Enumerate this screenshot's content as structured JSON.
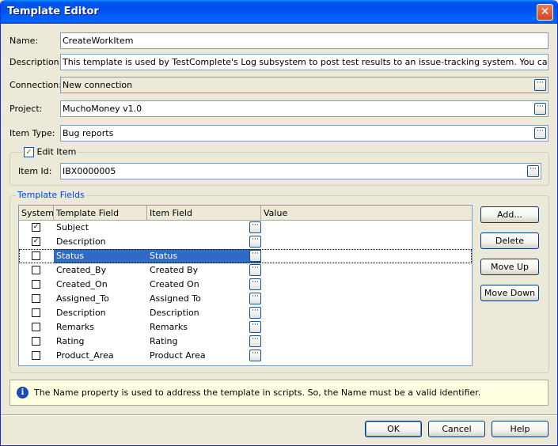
{
  "window": {
    "title": "Template Editor",
    "close_glyph": "✕"
  },
  "form": {
    "name_label": "Name:",
    "name_value": "CreateWorkItem",
    "description_label": "Description:",
    "description_value": "This template is used by TestComplete's Log subsystem to post test results to an issue-tracking system. You can also use it at y",
    "connection_label": "Connection:",
    "connection_value": "New connection",
    "project_label": "Project:",
    "project_value": "MuchoMoney v1.0",
    "itemtype_label": "Item Type:",
    "itemtype_value": "Bug reports"
  },
  "edit_item": {
    "checkbox_label": "Edit Item",
    "checked": true,
    "itemid_label": "Item Id:",
    "itemid_value": "IBX0000005"
  },
  "template_fields": {
    "group_label": "Template Fields",
    "columns": [
      "System",
      "Template Field",
      "Item Field",
      "Value"
    ],
    "rows": [
      {
        "system": true,
        "template_field": "Subject",
        "item_field": "",
        "value": ""
      },
      {
        "system": true,
        "template_field": "Description",
        "item_field": "",
        "value": ""
      },
      {
        "system": false,
        "template_field": "Status",
        "item_field": "Status",
        "value": "",
        "selected": true
      },
      {
        "system": false,
        "template_field": "Created_By",
        "item_field": "Created By",
        "value": ""
      },
      {
        "system": false,
        "template_field": "Created_On",
        "item_field": "Created On",
        "value": ""
      },
      {
        "system": false,
        "template_field": "Assigned_To",
        "item_field": "Assigned To",
        "value": ""
      },
      {
        "system": false,
        "template_field": "Description",
        "item_field": "Description",
        "value": ""
      },
      {
        "system": false,
        "template_field": "Remarks",
        "item_field": "Remarks",
        "value": ""
      },
      {
        "system": false,
        "template_field": "Rating",
        "item_field": "Rating",
        "value": ""
      },
      {
        "system": false,
        "template_field": "Product_Area",
        "item_field": "Product Area",
        "value": ""
      }
    ],
    "buttons": {
      "add": "Add...",
      "delete": "Delete",
      "move_up": "Move Up",
      "move_down": "Move Down"
    }
  },
  "info": {
    "icon": "info-icon",
    "text": "The Name property is used to address the template in scripts. So, the Name must be a valid identifier."
  },
  "footer": {
    "ok": "OK",
    "cancel": "Cancel",
    "help": "Help"
  },
  "glyphs": {
    "ellipsis": "···",
    "check": "✓"
  },
  "colors": {
    "title_blue": "#0054e3",
    "selection": "#316ac5",
    "info_bg": "#ffffe1"
  }
}
